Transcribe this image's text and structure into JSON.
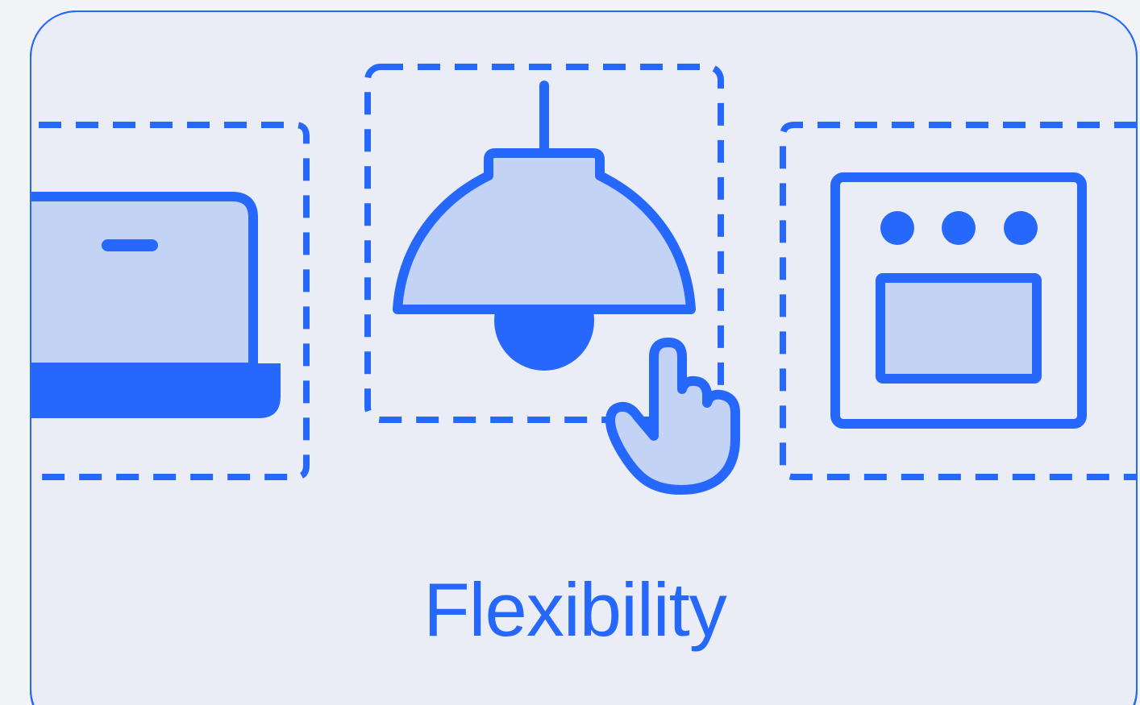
{
  "feature_card": {
    "title": "Flexibility",
    "accent_color": "#2568fb",
    "fill_color": "#c3d3f5",
    "background_color": "#ebedf6",
    "items": [
      {
        "icon": "laptop-icon"
      },
      {
        "icon": "pendant-lamp-icon",
        "selected": true,
        "cursor": "pointing-hand-icon"
      },
      {
        "icon": "oven-icon"
      }
    ]
  }
}
